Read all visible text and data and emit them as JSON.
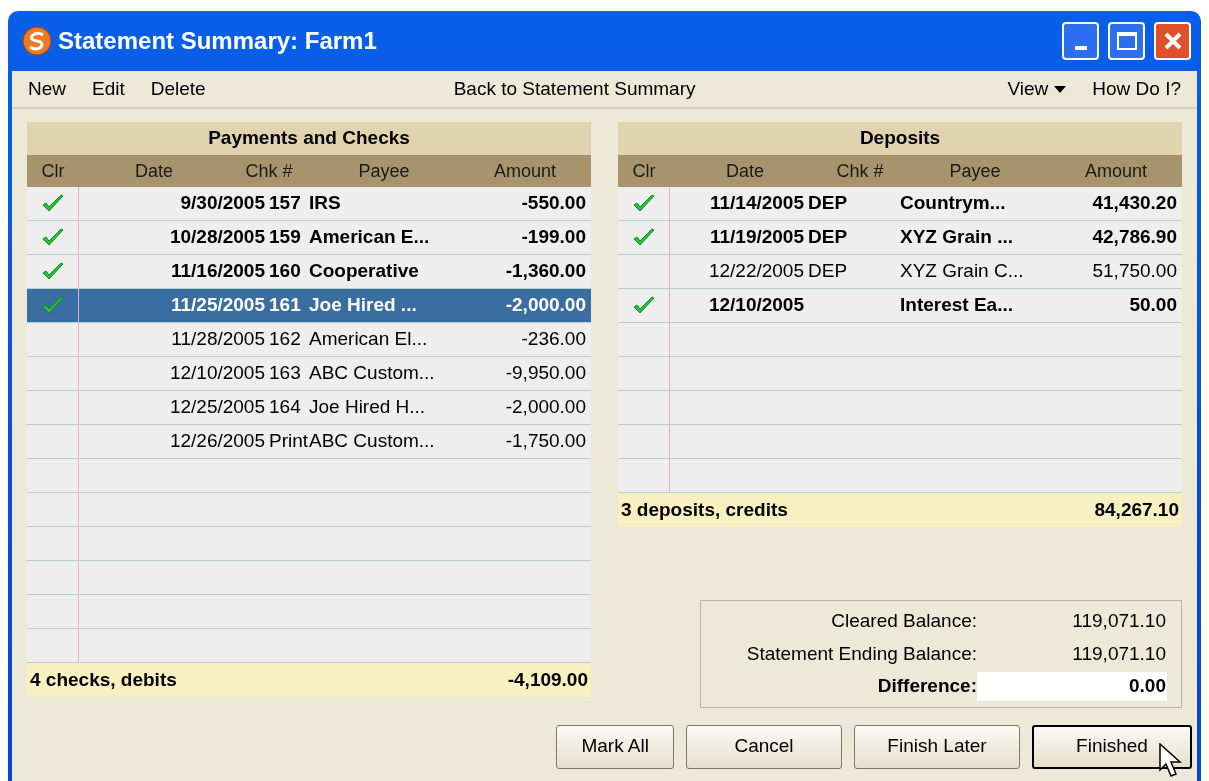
{
  "window": {
    "title": "Statement Summary: Farm1"
  },
  "menu": {
    "left": [
      "New",
      "Edit",
      "Delete"
    ],
    "center": "Back to Statement Summary",
    "view": "View",
    "help": "How Do I?"
  },
  "payments": {
    "title": "Payments and Checks",
    "columns": [
      "Clr",
      "Date",
      "Chk #",
      "Payee",
      "Amount"
    ],
    "rows": [
      {
        "cleared": true,
        "selected": false,
        "date": "9/30/2005",
        "chk": "157",
        "payee": "IRS",
        "amount": "-550.00"
      },
      {
        "cleared": true,
        "selected": false,
        "date": "10/28/2005",
        "chk": "159",
        "payee": "American E...",
        "amount": "-199.00"
      },
      {
        "cleared": true,
        "selected": false,
        "date": "11/16/2005",
        "chk": "160",
        "payee": "Cooperative",
        "amount": "-1,360.00"
      },
      {
        "cleared": true,
        "selected": true,
        "date": "11/25/2005",
        "chk": "161",
        "payee": "Joe Hired ...",
        "amount": "-2,000.00"
      },
      {
        "cleared": false,
        "selected": false,
        "date": "11/28/2005",
        "chk": "162",
        "payee": "American El...",
        "amount": "-236.00"
      },
      {
        "cleared": false,
        "selected": false,
        "date": "12/10/2005",
        "chk": "163",
        "payee": "ABC Custom...",
        "amount": "-9,950.00"
      },
      {
        "cleared": false,
        "selected": false,
        "date": "12/25/2005",
        "chk": "164",
        "payee": "Joe Hired H...",
        "amount": "-2,000.00"
      },
      {
        "cleared": false,
        "selected": false,
        "date": "12/26/2005",
        "chk": "Print",
        "payee": "ABC Custom...",
        "amount": "-1,750.00"
      }
    ],
    "footer_label": "4 checks, debits",
    "footer_total": "-4,109.00"
  },
  "deposits": {
    "title": "Deposits",
    "columns": [
      "Clr",
      "Date",
      "Chk #",
      "Payee",
      "Amount"
    ],
    "rows": [
      {
        "cleared": true,
        "selected": false,
        "date": "11/14/2005",
        "chk": "DEP",
        "payee": "Countrym...",
        "amount": "41,430.20"
      },
      {
        "cleared": true,
        "selected": false,
        "date": "11/19/2005",
        "chk": "DEP",
        "payee": "XYZ Grain ...",
        "amount": "42,786.90"
      },
      {
        "cleared": false,
        "selected": false,
        "date": "12/22/2005",
        "chk": "DEP",
        "payee": "XYZ Grain C...",
        "amount": "51,750.00"
      },
      {
        "cleared": true,
        "selected": false,
        "date": "12/10/2005",
        "payee": "Interest Ea...",
        "amount": "50.00"
      }
    ],
    "footer_label": "3 deposits, credits",
    "footer_total": "84,267.10"
  },
  "summary": [
    {
      "label": "Cleared Balance:",
      "value": "119,071.10",
      "emphasis": false
    },
    {
      "label": "Statement Ending Balance:",
      "value": "119,071.10",
      "emphasis": false
    },
    {
      "label": "Difference:",
      "value": "0.00",
      "emphasis": true
    }
  ],
  "buttons": [
    {
      "label": "Mark All",
      "default": false
    },
    {
      "label": "Cancel",
      "default": false
    },
    {
      "label": "Finish Later",
      "default": false
    },
    {
      "label": "Finished",
      "default": true
    }
  ]
}
